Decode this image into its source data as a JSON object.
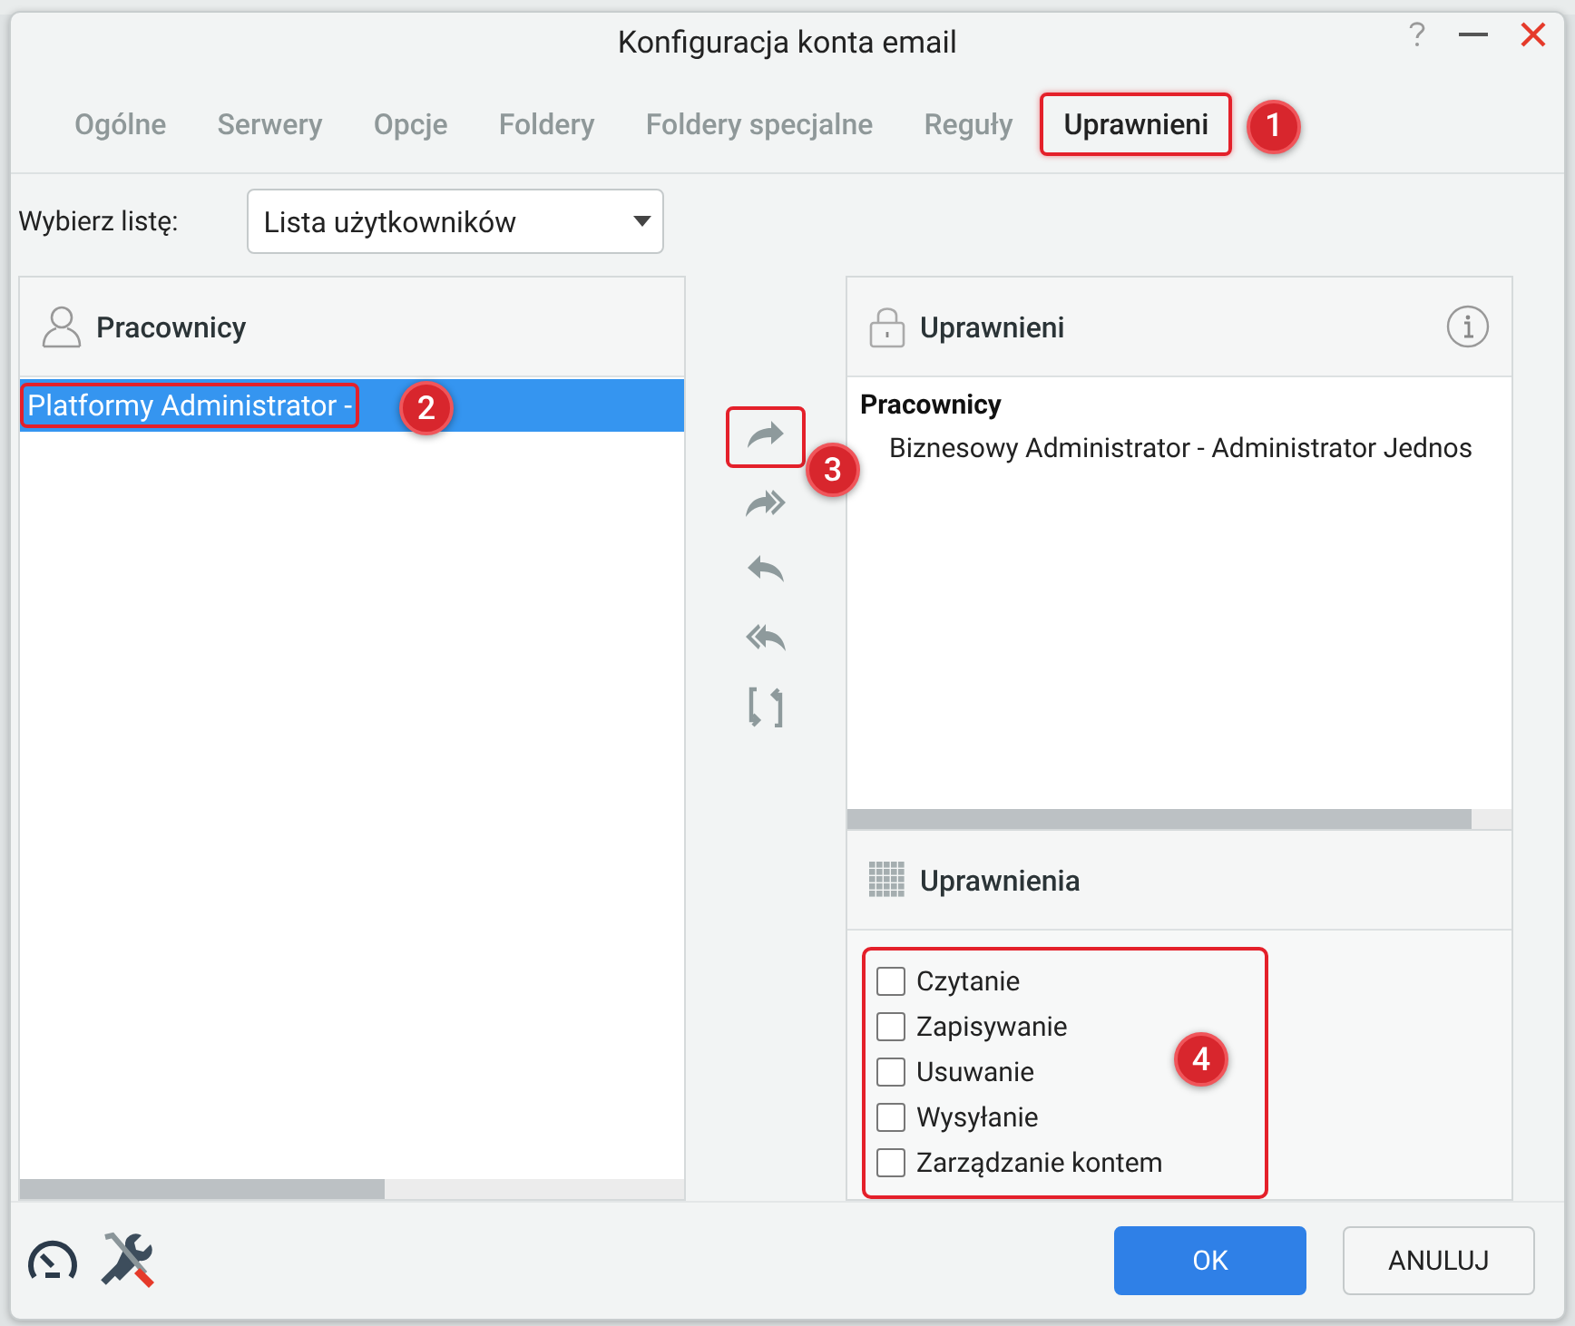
{
  "window": {
    "title": "Konfiguracja konta email"
  },
  "tabs": [
    {
      "label": "Ogólne",
      "selected": false
    },
    {
      "label": "Serwery",
      "selected": false
    },
    {
      "label": "Opcje",
      "selected": false
    },
    {
      "label": "Foldery",
      "selected": false
    },
    {
      "label": "Foldery specjalne",
      "selected": false
    },
    {
      "label": "Reguły",
      "selected": false
    },
    {
      "label": "Uprawnieni",
      "selected": true,
      "callout": "1"
    }
  ],
  "list_selector": {
    "label": "Wybierz listę:",
    "value": "Lista użytkowników"
  },
  "source_panel": {
    "title": "Pracownicy",
    "items": [
      {
        "label": "Platformy Administrator -",
        "selected": true,
        "callout": "2"
      }
    ]
  },
  "transfer_toolbar": {
    "callout": "3"
  },
  "assigned_panel": {
    "title": "Uprawnieni",
    "groups": [
      {
        "label": "Pracownicy",
        "children": [
          {
            "label": "Biznesowy Administrator - Administrator Jednos"
          }
        ]
      }
    ]
  },
  "permissions_panel": {
    "title": "Uprawnienia",
    "callout": "4",
    "items": [
      {
        "label": "Czytanie",
        "checked": false
      },
      {
        "label": "Zapisywanie",
        "checked": false
      },
      {
        "label": "Usuwanie",
        "checked": false
      },
      {
        "label": "Wysyłanie",
        "checked": false
      },
      {
        "label": "Zarządzanie kontem",
        "checked": false
      }
    ]
  },
  "buttons": [
    {
      "label": "OK",
      "kind": "primary"
    },
    {
      "label": "ANULUJ",
      "kind": "secondary"
    }
  ]
}
